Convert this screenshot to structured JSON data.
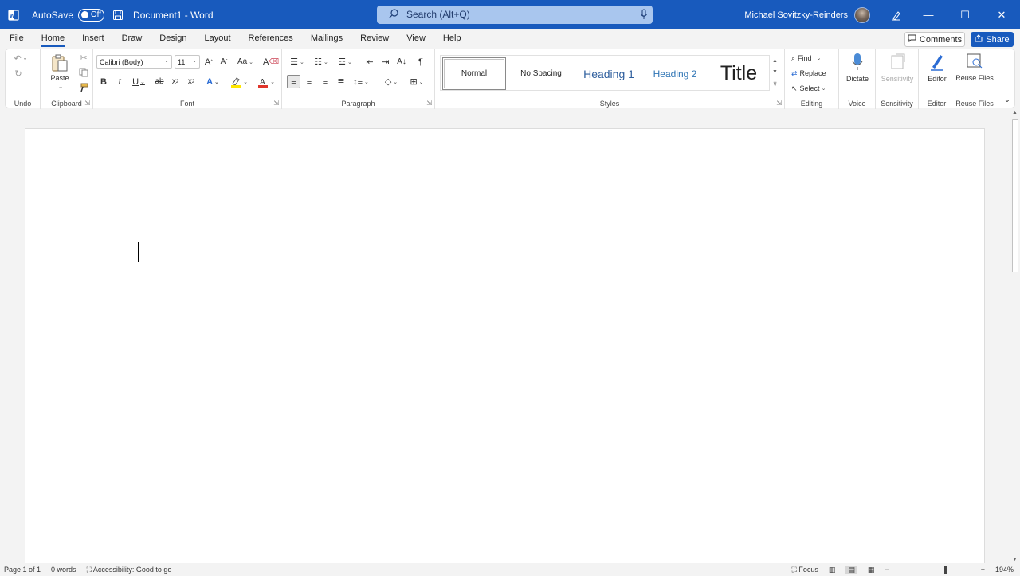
{
  "titlebar": {
    "autosave_label": "AutoSave",
    "autosave_state": "Off",
    "doc_name": "Document1  -  Word",
    "search_placeholder": "Search (Alt+Q)",
    "user_name": "Michael Sovitzky-Reinders",
    "accent_color": "#185abd"
  },
  "tabs": [
    {
      "label": "File"
    },
    {
      "label": "Home",
      "active": true
    },
    {
      "label": "Insert"
    },
    {
      "label": "Draw"
    },
    {
      "label": "Design"
    },
    {
      "label": "Layout"
    },
    {
      "label": "References"
    },
    {
      "label": "Mailings"
    },
    {
      "label": "Review"
    },
    {
      "label": "View"
    },
    {
      "label": "Help"
    }
  ],
  "actions": {
    "comments_label": "Comments",
    "share_label": "Share"
  },
  "ribbon": {
    "groups": {
      "undo": "Undo",
      "clipboard": "Clipboard",
      "font": "Font",
      "paragraph": "Paragraph",
      "styles": "Styles",
      "editing": "Editing",
      "voice": "Voice",
      "sensitivity": "Sensitivity",
      "editor": "Editor",
      "reuse_files": "Reuse Files"
    },
    "paste_label": "Paste",
    "font_name": "Calibri (Body)",
    "font_size": "11",
    "styles": [
      "Normal",
      "No Spacing",
      "Heading 1",
      "Heading 2",
      "Title"
    ],
    "find_label": "Find",
    "replace_label": "Replace",
    "select_label": "Select",
    "dictate_label": "Dictate",
    "sensitivity_label": "Sensitivity",
    "editor_label": "Editor",
    "reuse_files_label": "Reuse Files"
  },
  "statusbar": {
    "page": "Page 1 of 1",
    "words": "0 words",
    "accessibility": "Accessibility: Good to go",
    "focus": "Focus",
    "zoom": "194%",
    "zoom_fraction": 0.61
  }
}
